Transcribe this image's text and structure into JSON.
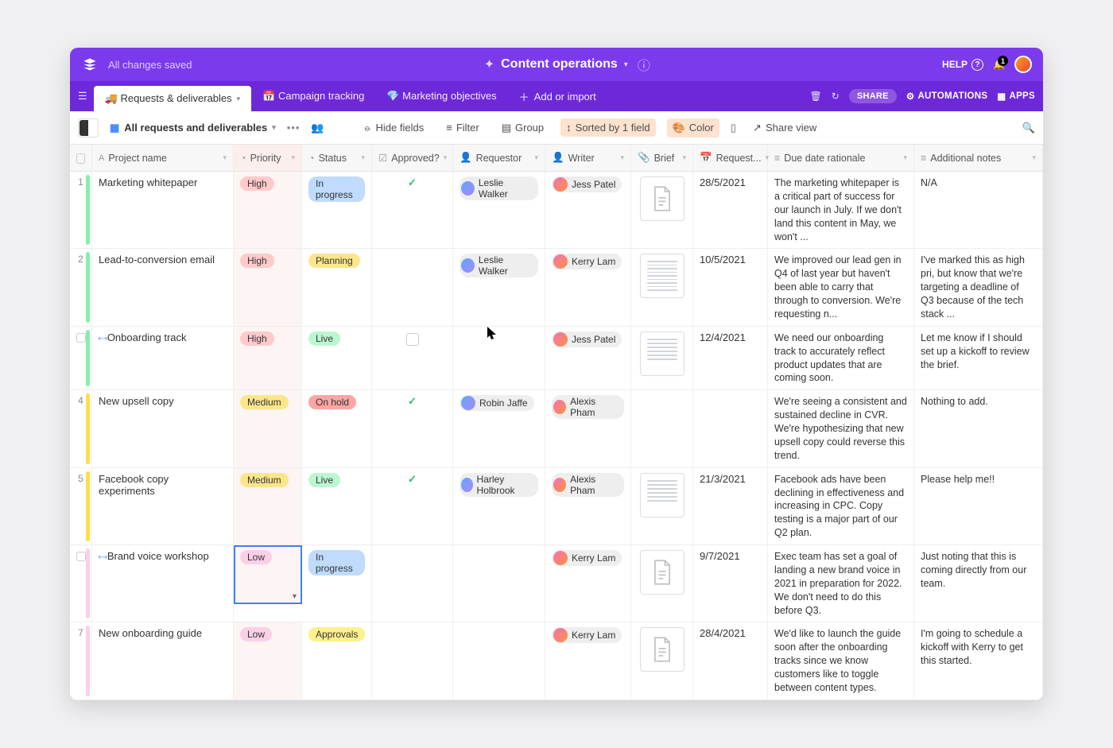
{
  "header": {
    "save_status": "All changes saved",
    "base_name": "Content operations",
    "help": "HELP",
    "notification_count": "1"
  },
  "tabs": {
    "active": "🚚 Requests & deliverables",
    "t1": "📅 Campaign tracking",
    "t2": "💎 Marketing objectives",
    "add": "Add or import",
    "share": "SHARE",
    "automations": "AUTOMATIONS",
    "apps": "APPS"
  },
  "viewbar": {
    "view_name": "All requests and deliverables",
    "hide": "Hide fields",
    "filter": "Filter",
    "group": "Group",
    "sort": "Sorted by 1 field",
    "color": "Color",
    "share_view": "Share view"
  },
  "columns": {
    "name": "Project name",
    "priority": "Priority",
    "status": "Status",
    "approved": "Approved?",
    "requestor": "Requestor",
    "writer": "Writer",
    "brief": "Brief",
    "request_date": "Request...",
    "rationale": "Due date rationale",
    "notes": "Additional notes"
  },
  "rows": [
    {
      "num": "1",
      "bar": "#86efac",
      "name": "Marketing whitepaper",
      "priority": "High",
      "priority_cls": "p-high",
      "status": "In progress",
      "status_cls": "s-inprogress",
      "approved": "✓",
      "requestor": "Leslie Walker",
      "writer": "Jess Patel",
      "brief": "icon",
      "date": "28/5/2021",
      "rationale": "The marketing whitepaper is a critical part of success for our launch in July. If we don't land this content in May, we won't ...",
      "notes": "N/A"
    },
    {
      "num": "2",
      "bar": "#86efac",
      "name": "Lead-to-conversion email",
      "priority": "High",
      "priority_cls": "p-high",
      "status": "Planning",
      "status_cls": "s-planning",
      "approved": "",
      "requestor": "Leslie Walker",
      "writer": "Kerry Lam",
      "brief": "dense",
      "date": "10/5/2021",
      "rationale": "We improved our lead gen in Q4 of last year but haven't been able to carry that through to conversion. We're requesting n...",
      "notes": "I've marked this as high pri, but know that we're targeting a deadline of Q3 because of the tech stack ..."
    },
    {
      "num": "",
      "bar": "#86efac",
      "expand": true,
      "name": "Onboarding track",
      "priority": "High",
      "priority_cls": "p-high",
      "status": "Live",
      "status_cls": "s-live",
      "approved": "box",
      "requestor": "",
      "writer": "Jess Patel",
      "brief": "thumb",
      "date": "12/4/2021",
      "rationale": "We need our onboarding track to accurately reflect product updates that are coming soon.",
      "notes": "Let me know if I should set up a kickoff to review the brief."
    },
    {
      "num": "4",
      "bar": "#fde047",
      "name": "New upsell copy",
      "priority": "Medium",
      "priority_cls": "p-medium",
      "status": "On hold",
      "status_cls": "s-onhold",
      "approved": "✓",
      "requestor": "Robin Jaffe",
      "writer": "Alexis Pham",
      "brief": "",
      "date": "",
      "rationale": "We're seeing a consistent and sustained decline in CVR. We're hypothesizing that new upsell copy could reverse this trend.",
      "notes": "Nothing to add."
    },
    {
      "num": "5",
      "bar": "#fde047",
      "name": "Facebook copy experiments",
      "priority": "Medium",
      "priority_cls": "p-medium",
      "status": "Live",
      "status_cls": "s-live",
      "approved": "✓",
      "requestor": "Harley Holbrook",
      "writer": "Alexis Pham",
      "brief": "thumb",
      "date": "21/3/2021",
      "rationale": "Facebook ads have been declining in effectiveness and increasing in CPC. Copy testing is a major part of our Q2 plan.",
      "notes": "Please help me!!"
    },
    {
      "num": "",
      "bar": "#fbcfe8",
      "expand": true,
      "selected_priority": true,
      "name": "Brand voice workshop",
      "priority": "Low",
      "priority_cls": "p-low",
      "status": "In progress",
      "status_cls": "s-inprogress",
      "approved": "",
      "requestor": "",
      "writer": "Kerry Lam",
      "brief": "icon",
      "date": "9/7/2021",
      "rationale": "Exec team has set a goal of landing a new brand voice in 2021 in preparation for 2022. We don't need to do this before Q3.",
      "notes": "Just noting that this is coming directly from our team."
    },
    {
      "num": "7",
      "bar": "#fbcfe8",
      "name": "New onboarding guide",
      "priority": "Low",
      "priority_cls": "p-low",
      "status": "Approvals",
      "status_cls": "s-approvals",
      "approved": "",
      "requestor": "",
      "writer": "Kerry Lam",
      "brief": "icon",
      "date": "28/4/2021",
      "rationale": "We'd like to launch the guide soon after the onboarding tracks since we know customers like to toggle between content types.",
      "notes": "I'm going to schedule a kickoff with Kerry to get this started."
    }
  ]
}
